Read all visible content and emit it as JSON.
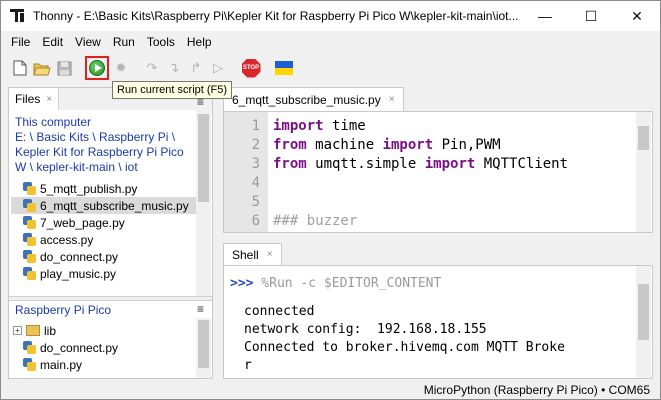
{
  "window": {
    "title": "Thonny  -  E:\\Basic Kits\\Raspberry Pi\\Kepler Kit for Raspberry Pi Pico W\\kepler-kit-main\\iot...",
    "minimize": "—",
    "maximize": "☐",
    "close": "✕"
  },
  "menu": [
    "File",
    "Edit",
    "View",
    "Run",
    "Tools",
    "Help"
  ],
  "tooltip": "Run current script (F5)",
  "toolbar": {
    "stop_label": "STOP"
  },
  "files_panel": {
    "tab_label": "Files",
    "tab_close": "×",
    "menu_glyph": "≡",
    "computer": {
      "heading": "This computer",
      "path": "E: \\ Basic Kits \\ Raspberry Pi \\ Kepler Kit for Raspberry Pi Pico W \\ kepler-kit-main \\ iot",
      "files": [
        "5_mqtt_publish.py",
        "6_mqtt_subscribe_music.py",
        "7_web_page.py",
        "access.py",
        "do_connect.py",
        "play_music.py"
      ],
      "selected_index": 1
    },
    "pico": {
      "heading": "Raspberry Pi Pico",
      "expander": "+",
      "items": [
        {
          "type": "folder",
          "name": "lib"
        },
        {
          "type": "file",
          "name": "do_connect.py"
        },
        {
          "type": "file",
          "name": "main.py"
        }
      ]
    }
  },
  "editor": {
    "tab_label": "6_mqtt_subscribe_music.py",
    "tab_close": "×",
    "line_numbers": [
      "1",
      "2",
      "3",
      "4",
      "5",
      "6"
    ],
    "lines": [
      [
        {
          "t": "import",
          "k": true
        },
        {
          "t": " time"
        }
      ],
      [
        {
          "t": "from",
          "k": true
        },
        {
          "t": " machine "
        },
        {
          "t": "import",
          "k": true
        },
        {
          "t": " Pin,PWM"
        }
      ],
      [
        {
          "t": "from",
          "k": true
        },
        {
          "t": " umqtt.simple "
        },
        {
          "t": "import",
          "k": true
        },
        {
          "t": " MQTTClient"
        }
      ],
      [],
      [],
      [
        {
          "t": "### buzzer",
          "c": true
        }
      ]
    ]
  },
  "shell": {
    "tab_label": "Shell",
    "tab_close": "×",
    "prompt": ">>>",
    "command": " %Run -c $EDITOR_CONTENT",
    "output": [
      "connected",
      "network config:  192.168.18.155",
      "Connected to broker.hivemq.com MQTT Broke",
      "r"
    ]
  },
  "status": {
    "interpreter": "MicroPython (Raspberry Pi Pico)  •  COM65"
  }
}
